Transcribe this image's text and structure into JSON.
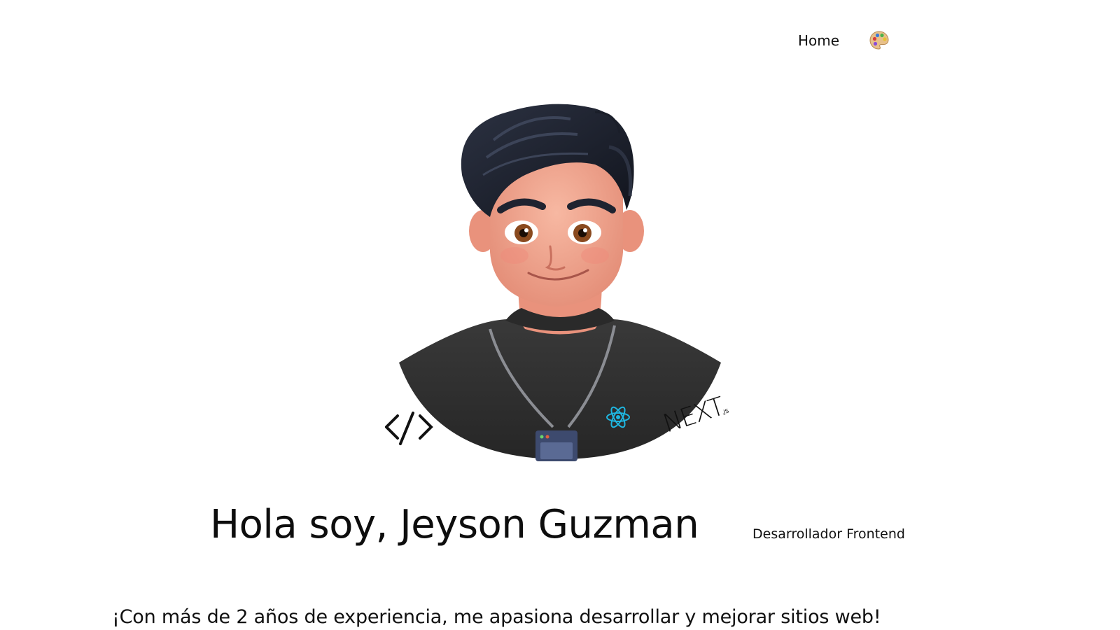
{
  "nav": {
    "home_label": "Home",
    "theme_icon": "palette-icon"
  },
  "hero": {
    "title": "Hola soy, Jeyson Guzman",
    "role": "Desarrollador Frontend"
  },
  "tagline": "¡Con más de 2 años de experiencia, me apasiona desarrollar y mejorar sitios web!",
  "avatar": {
    "left_sticker": "</>",
    "right_sticker": "NEXT",
    "right_sticker_sub": ".JS"
  },
  "colors": {
    "background": "#ffffff",
    "text": "#111111",
    "shirt": "#333333",
    "hair": "#1b1f2b",
    "react_blue": "#1fb6e0"
  }
}
